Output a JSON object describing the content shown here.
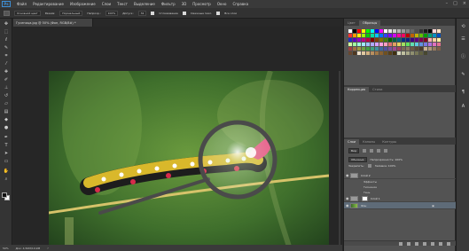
{
  "app": {
    "logo": "Ps"
  },
  "menu": [
    "Файл",
    "Редактирование",
    "Изображение",
    "Слои",
    "Текст",
    "Выделение",
    "Фильтр",
    "3D",
    "Просмотр",
    "Окно",
    "Справка"
  ],
  "window_controls": [
    "–",
    "□",
    "×"
  ],
  "options": {
    "preset": "Основной цвет",
    "mode_label": "Режим:",
    "mode_value": "Нормальный",
    "opacity_label": "Непрозр.:",
    "opacity_value": "100%",
    "flow_label": "Допуск:",
    "flow_value": "32",
    "antialias": "Сглаживание",
    "contiguous": "Смежные пикс.",
    "all_layers": "Все слои"
  },
  "document": {
    "tab": "Гусеница.jpg @ 50% (Фон, RGB/8#) *"
  },
  "status": {
    "zoom": "50%",
    "doc_size": "Док: 4,50M/10,9M"
  },
  "panels": {
    "top_tabs": [
      "Цвет",
      "Образцы"
    ],
    "active_top_tab": "Образцы",
    "adjust_tabs": [
      "Коррекция",
      "Стили"
    ],
    "layers_tabs": [
      "Слои",
      "Каналы",
      "Контуры"
    ],
    "active_layers_tab": "Слои",
    "filter_label": "Вид",
    "blend_mode": "Обычные",
    "opacity_label": "Непрозрачность: 100%",
    "lock_label": "Закрепить:",
    "fill_label": "Заливка: 100%",
    "layers": [
      {
        "name": "Слой 2",
        "selected": false
      },
      {
        "name": "Слой 1",
        "selected": false
      },
      {
        "name": "Фон",
        "selected": true
      }
    ],
    "effects": [
      "Эффекты",
      "Тиснение",
      "Тень"
    ]
  },
  "swatch_colors": [
    "#ffffff",
    "#000000",
    "#ff0000",
    "#ffff00",
    "#00ff00",
    "#00ffff",
    "#0000ff",
    "#ff00ff",
    "#ffffff",
    "#e6e6e6",
    "#cccccc",
    "#b3b3b3",
    "#999999",
    "#808080",
    "#666666",
    "#4d4d4d",
    "#333333",
    "#1a1a1a",
    "#000000",
    "#ffd7d7",
    "#ffe0c0",
    "#ff3030",
    "#ff9a00",
    "#ffee00",
    "#9aff00",
    "#00d000",
    "#00e0a0",
    "#00c8ff",
    "#0070ff",
    "#3040ff",
    "#8000ff",
    "#d000ff",
    "#ff00a0",
    "#ff0060",
    "#c00000",
    "#c06000",
    "#c0b000",
    "#60c000",
    "#00a000",
    "#00a070",
    "#0090c0",
    "#0050c0",
    "#2030c0",
    "#6000c0",
    "#9800c0",
    "#c00080",
    "#c00040",
    "#800000",
    "#804000",
    "#807000",
    "#408000",
    "#006000",
    "#006040",
    "#006080",
    "#003080",
    "#102080",
    "#400080",
    "#600080",
    "#800050",
    "#800020",
    "#ffb0b0",
    "#ffd0a0",
    "#fff0a0",
    "#d0ffa0",
    "#a0ffa0",
    "#a0ffe0",
    "#a0e8ff",
    "#a0c0ff",
    "#b0a8ff",
    "#d8a0ff",
    "#ffa0e0",
    "#ffa0c0",
    "#e07070",
    "#e0a060",
    "#e0d060",
    "#a0e060",
    "#60e060",
    "#60e0b0",
    "#60c8e0",
    "#6090e0",
    "#7878e0",
    "#b070e0",
    "#e070c0",
    "#e07090",
    "#a04040",
    "#a07040",
    "#a09a40",
    "#70a040",
    "#40a040",
    "#40a080",
    "#4090a0",
    "#4068a0",
    "#5050a0",
    "#7850a0",
    "#a04890",
    "#a04060",
    "#7a6a55",
    "#8a7a60",
    "#6a5a45",
    "#5a4a35",
    "#4a3a2a",
    "#c8b090",
    "#b09878",
    "#987c60",
    "#806048",
    "#684830",
    "#503820",
    "#f0e0c8",
    "#e0c8a0",
    "#d0b080",
    "#b89060",
    "#a07848",
    "#886030",
    "#705020",
    "#584018",
    "#403010",
    "#d8d8c0",
    "#c0c0a0",
    "#a8a888",
    "#909070",
    "#787858",
    "#606040",
    "#484830"
  ],
  "icons": {
    "tools": [
      "move-icon",
      "marquee-icon",
      "lasso-icon",
      "quick-select-icon",
      "crop-icon",
      "eyedropper-icon",
      "healing-icon",
      "brush-icon",
      "stamp-icon",
      "history-brush-icon",
      "eraser-icon",
      "gradient-icon",
      "blur-icon",
      "dodge-icon",
      "pen-icon",
      "type-icon",
      "path-select-icon",
      "shape-icon",
      "hand-icon",
      "zoom-icon"
    ],
    "dock": [
      "history-icon",
      "properties-icon",
      "info-icon",
      "brushes-icon",
      "paragraph-icon",
      "character-icon"
    ]
  }
}
